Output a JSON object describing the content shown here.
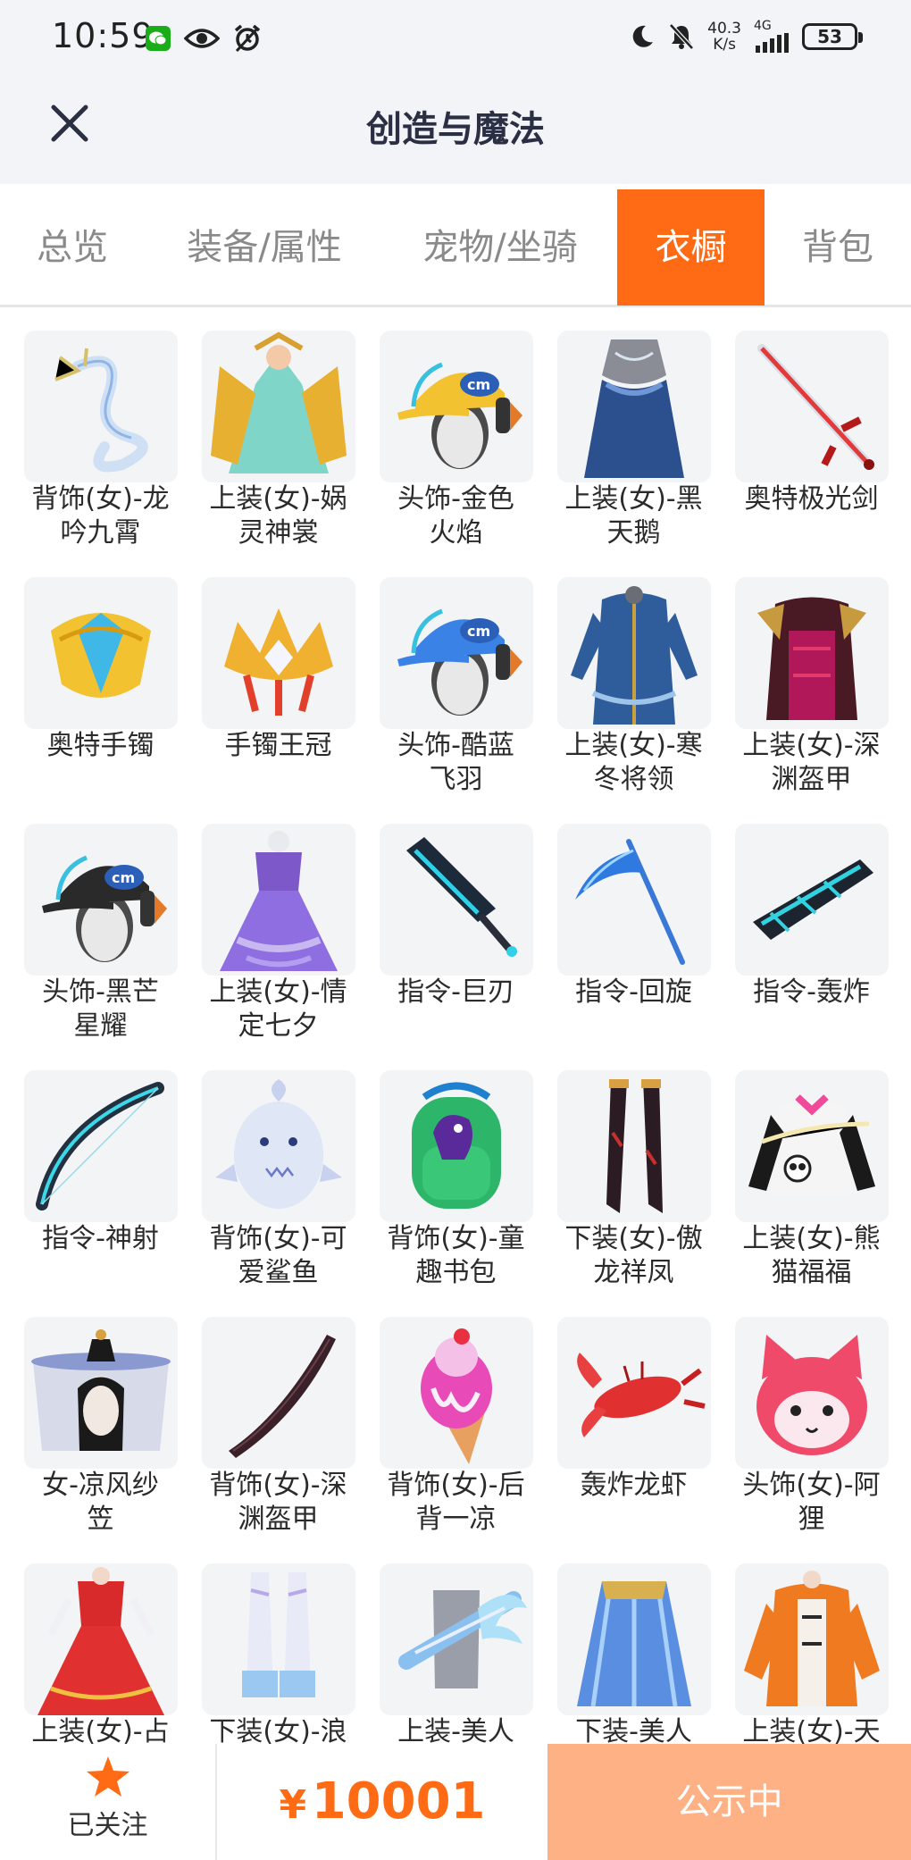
{
  "status_bar": {
    "time": "10:59",
    "net_speed": "40.3",
    "net_speed_unit": "K/s",
    "network": "4G",
    "battery": "53"
  },
  "header": {
    "title": "创造与魔法"
  },
  "tabs": [
    {
      "label": "总览"
    },
    {
      "label": "装备/属性"
    },
    {
      "label": "宠物/坐骑"
    },
    {
      "label": "衣橱",
      "active": true
    },
    {
      "label": "背包"
    }
  ],
  "items": [
    {
      "name": "背饰(女)-龙吟九霄",
      "line1": "背饰(女)-龙",
      "line2": "吟九霄",
      "icon": "white-dragon"
    },
    {
      "name": "上装(女)-娲灵神裳",
      "line1": "上装(女)-娲",
      "line2": "灵神裳",
      "icon": "goddess-dress"
    },
    {
      "name": "头饰-金色火焰",
      "line1": "头饰-金色",
      "line2": "火焰",
      "icon": "gold-cap",
      "color": "#f2c230"
    },
    {
      "name": "上装(女)-黑天鹅",
      "line1": "上装(女)-黑",
      "line2": "天鹅",
      "icon": "blue-gown"
    },
    {
      "name": "奥特极光剑",
      "line1": "奥特极光剑",
      "line2": "",
      "icon": "red-sword"
    },
    {
      "name": "奥特手镯",
      "line1": "奥特手镯",
      "line2": "",
      "icon": "gold-bracelet"
    },
    {
      "name": "手镯王冠",
      "line1": "手镯王冠",
      "line2": "",
      "icon": "crown"
    },
    {
      "name": "头饰-酷蓝飞羽",
      "line1": "头饰-酷蓝",
      "line2": "飞羽",
      "icon": "blue-cap",
      "color": "#3b82e6"
    },
    {
      "name": "上装(女)-寒冬将领",
      "line1": "上装(女)-寒",
      "line2": "冬将领",
      "icon": "blue-uniform"
    },
    {
      "name": "上装(女)-深渊盔甲",
      "line1": "上装(女)-深",
      "line2": "渊盔甲",
      "icon": "abyss-armor"
    },
    {
      "name": "头饰-黑芒星耀",
      "line1": "头饰-黑芒",
      "line2": "星耀",
      "icon": "black-cap",
      "color": "#2a2a2a"
    },
    {
      "name": "上装(女)-情定七夕",
      "line1": "上装(女)-情",
      "line2": "定七夕",
      "icon": "purple-gown"
    },
    {
      "name": "指令-巨刃",
      "line1": "指令-巨刃",
      "line2": "",
      "icon": "great-blade"
    },
    {
      "name": "指令-回旋",
      "line1": "指令-回旋",
      "line2": "",
      "icon": "scythe"
    },
    {
      "name": "指令-轰炸",
      "line1": "指令-轰炸",
      "line2": "",
      "icon": "gunblade"
    },
    {
      "name": "指令-神射",
      "line1": "指令-神射",
      "line2": "",
      "icon": "bow"
    },
    {
      "name": "背饰(女)-可爱鲨鱼",
      "line1": "背饰(女)-可",
      "line2": "爱鲨鱼",
      "icon": "shark"
    },
    {
      "name": "背饰(女)-童趣书包",
      "line1": "背饰(女)-童",
      "line2": "趣书包",
      "icon": "dino-backpack"
    },
    {
      "name": "下装(女)-傲龙祥凤",
      "line1": "下装(女)-傲",
      "line2": "龙祥凤",
      "icon": "stockings"
    },
    {
      "name": "上装(女)-熊猫福福",
      "line1": "上装(女)-熊",
      "line2": "猫福福",
      "icon": "panda-top"
    },
    {
      "name": "女-凉风纱笠",
      "line1": "女-凉风纱",
      "line2": "笠",
      "icon": "veil-hat"
    },
    {
      "name": "背饰(女)-深渊盔甲",
      "line1": "背饰(女)-深",
      "line2": "渊盔甲",
      "icon": "dark-blade"
    },
    {
      "name": "背饰(女)-后背一凉",
      "line1": "背饰(女)-后",
      "line2": "背一凉",
      "icon": "ice-cream"
    },
    {
      "name": "轰炸龙虾",
      "line1": "轰炸龙虾",
      "line2": "",
      "icon": "lobster"
    },
    {
      "name": "头饰(女)-阿狸",
      "line1": "头饰(女)-阿",
      "line2": "狸",
      "icon": "fox-head"
    },
    {
      "name": "上装(女)-占",
      "line1": "上装(女)-占",
      "line2": "",
      "icon": "red-dress"
    },
    {
      "name": "下装(女)-浪",
      "line1": "下装(女)-浪",
      "line2": "",
      "icon": "white-boots"
    },
    {
      "name": "上装-美人",
      "line1": "上装-美人",
      "line2": "",
      "icon": "wing-shoulder"
    },
    {
      "name": "下装-美人",
      "line1": "下装-美人",
      "line2": "",
      "icon": "blue-skirt"
    },
    {
      "name": "上装(女)-天",
      "line1": "上装(女)-天",
      "line2": "",
      "icon": "orange-jacket"
    }
  ],
  "bottom_bar": {
    "follow_label": "已关注",
    "currency": "¥",
    "price": "10001",
    "status_button": "公示中"
  },
  "colors": {
    "accent": "#ff6a14",
    "status_button_bg": "#fdb184",
    "header_bg": "#f2f4f7"
  }
}
